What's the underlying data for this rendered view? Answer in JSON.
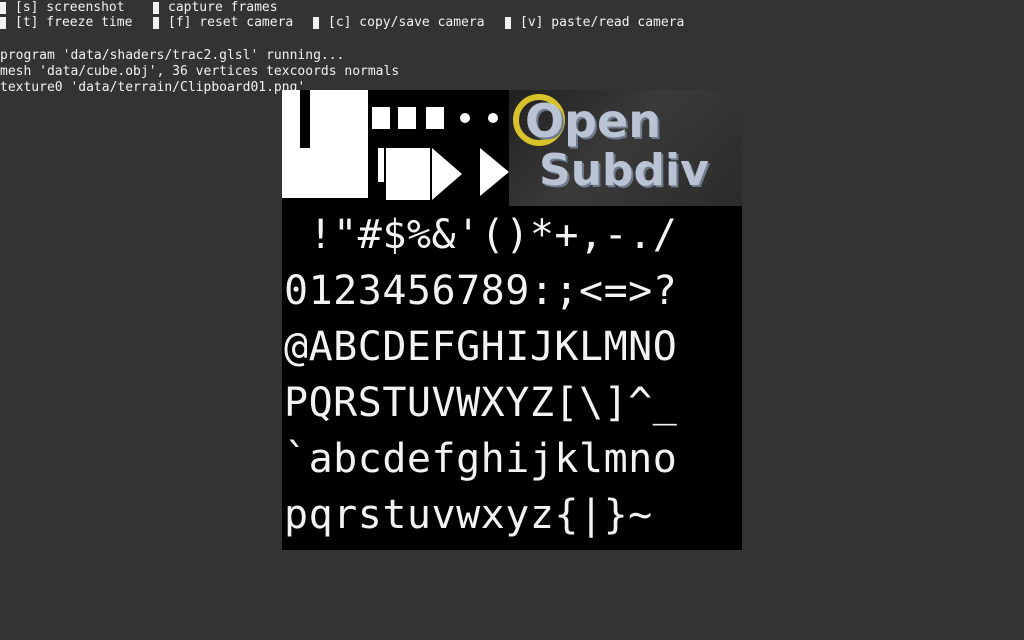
{
  "hud": {
    "items": [
      {
        "label": "[s] screenshot",
        "checked": false
      },
      {
        "label": "capture frames",
        "checked": false
      },
      {
        "label": "[t] freeze time",
        "checked": false
      },
      {
        "label": "[f] reset camera",
        "checked": false
      },
      {
        "label": "[c] copy/save camera",
        "checked": false
      },
      {
        "label": "[v] paste/read camera",
        "checked": false
      }
    ]
  },
  "status": {
    "lines": [
      "program 'data/shaders/trac2.glsl' running...",
      "mesh 'data/cube.obj', 36 vertices texcoords normals",
      "texture0 'data/terrain/Clipboard01.png'"
    ]
  },
  "texture": {
    "logo_line1": "Open",
    "logo_line2": "Subdiv",
    "rows": [
      " !\"#$%&'()*+,-./",
      "0123456789:;<=>?",
      "@ABCDEFGHIJKLMNO",
      "PQRSTUVWXYZ[\\]^_",
      "`abcdefghijklmno",
      "pqrstuvwxyz{|}~"
    ]
  }
}
